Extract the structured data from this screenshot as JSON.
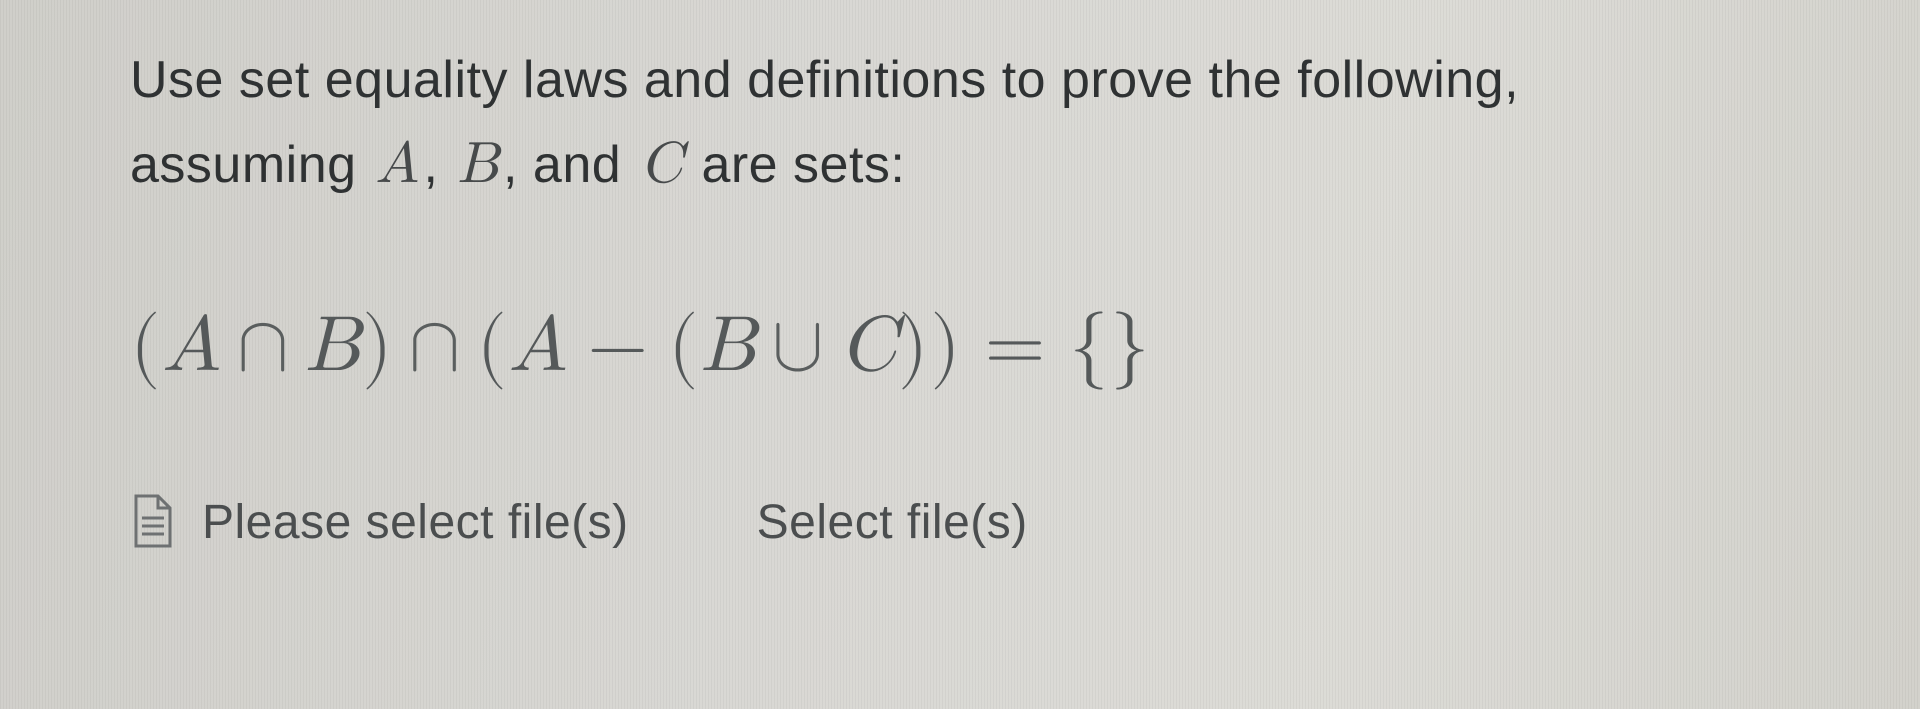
{
  "question": {
    "prompt_line1": "Use set equality laws and definitions to prove the following,",
    "prompt_line2_pre": "assuming ",
    "prompt_A": "A",
    "prompt_comma1": ", ",
    "prompt_B": "B",
    "prompt_comma2": ", and ",
    "prompt_C": "C",
    "prompt_line2_post": " are sets:",
    "equation_plain": "(A ∩ B) ∩ (A − (B ∪ C)) = {}",
    "eq": {
      "lp1": "(",
      "A1": "A",
      "cap1": "∩",
      "B1": "B",
      "rp1": ")",
      "cap2": "∩",
      "lp2": "(",
      "A2": "A",
      "minus": "−",
      "lp3": "(",
      "B2": "B",
      "cup": "∪",
      "C1": "C",
      "rp3": ")",
      "rp2": ")",
      "equals": "=",
      "empty": "{}"
    }
  },
  "upload": {
    "label": "Please select file(s)",
    "action": "Select file(s)"
  }
}
